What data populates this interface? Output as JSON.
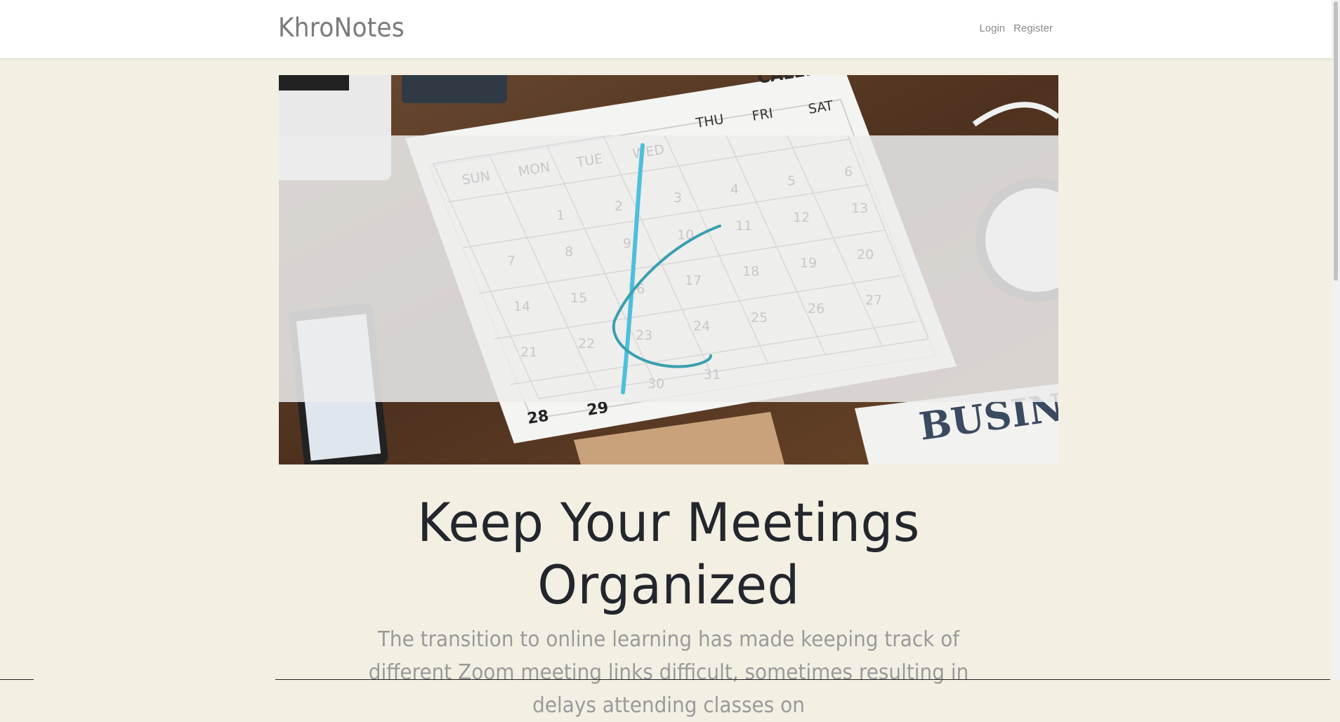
{
  "navbar": {
    "brand": "KhroNotes",
    "links": [
      "Login",
      "Register"
    ]
  },
  "hero": {
    "image_labels": {
      "calendar_heading": "CALEND",
      "days": [
        "SUN",
        "MON",
        "TUE",
        "WED",
        "THU",
        "FRI",
        "SAT"
      ],
      "dates": [
        "1",
        "2",
        "3",
        "4",
        "5",
        "6",
        "7",
        "8",
        "9",
        "10",
        "11",
        "12",
        "13",
        "14",
        "15",
        "16",
        "17",
        "18",
        "19",
        "20",
        "21",
        "22",
        "23",
        "24",
        "25",
        "26",
        "27",
        "28",
        "29",
        "30",
        "31"
      ],
      "newspaper": "BUSINE"
    },
    "logo_icon": "k-letter-logo-icon"
  },
  "main": {
    "headline": "Keep Your Meetings Organized",
    "intro": "The transition to online learning has made keeping track of different Zoom meeting links difficult, sometimes resulting in delays attending classes on"
  },
  "colors": {
    "background": "#f3f0e3",
    "logo_stroke": "#47b8d6",
    "headline": "#23262c"
  }
}
